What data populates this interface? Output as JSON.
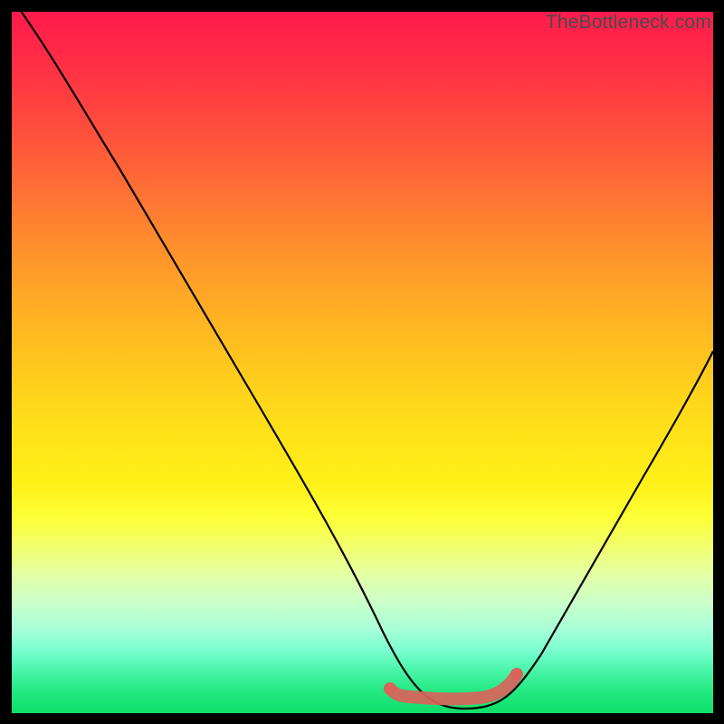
{
  "watermark": "TheBottleneck.com",
  "chart_data": {
    "type": "line",
    "title": "",
    "xlabel": "",
    "ylabel": "",
    "xlim": [
      0,
      100
    ],
    "ylim": [
      0,
      100
    ],
    "series": [
      {
        "name": "curve",
        "x": [
          0,
          3,
          7,
          12,
          18,
          24,
          30,
          36,
          42,
          47,
          52,
          55,
          58,
          61,
          64,
          67,
          70,
          74,
          78,
          82,
          86,
          90,
          94,
          98,
          100
        ],
        "values": [
          102,
          97,
          90,
          81,
          71,
          61,
          51,
          41,
          31,
          22,
          13,
          8,
          4,
          2,
          1,
          1,
          2,
          4,
          9,
          16,
          25,
          35,
          45,
          55,
          60
        ]
      }
    ],
    "highlight": {
      "name": "bottom-band",
      "x_start": 55,
      "x_end": 72,
      "y": 2
    }
  }
}
